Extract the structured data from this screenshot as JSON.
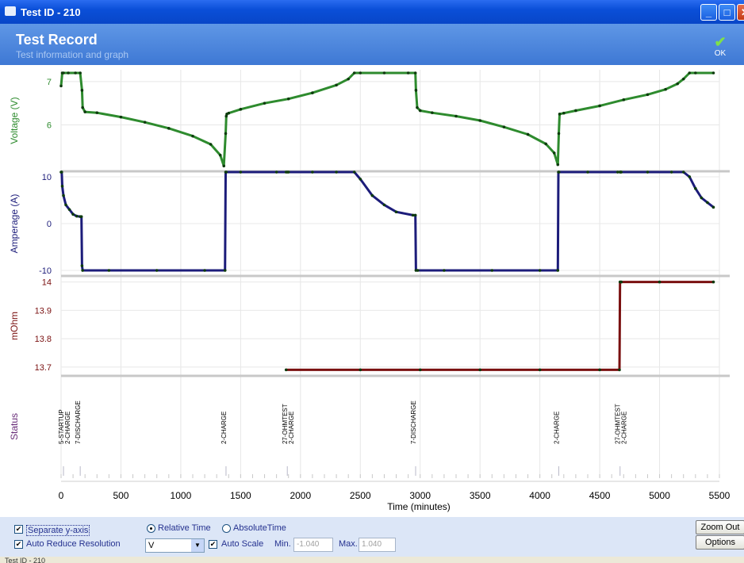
{
  "window": {
    "title": "Test ID - 210"
  },
  "header": {
    "title": "Test Record",
    "subtitle": "Test information and graph",
    "ok_label": "OK"
  },
  "chart_data": {
    "type": "line",
    "xlabel": "Time (minutes)",
    "xlim": [
      0,
      5500
    ],
    "x_ticks": [
      0,
      500,
      1000,
      1500,
      2000,
      2500,
      3000,
      3500,
      4000,
      4500,
      5000,
      5500
    ],
    "panels": [
      {
        "ylabel": "Voltage (V)",
        "color": "#2e8b2e",
        "y_ticks": [
          6,
          7
        ],
        "ylim": [
          5.0,
          7.2
        ],
        "series": [
          {
            "x": [
              0,
              10,
              20,
              60,
              120,
              160,
              175,
              180,
              200,
              300,
              500,
              700,
              900,
              1100,
              1250,
              1330,
              1360,
              1375,
              1380,
              1385,
              1400,
              1500,
              1700,
              1900,
              2100,
              2300,
              2400,
              2450,
              2500,
              2700,
              2900,
              2960,
              2965,
              2975,
              3000,
              3100,
              3300,
              3500,
              3700,
              3900,
              4050,
              4120,
              4150,
              4158,
              4165,
              4200,
              4300,
              4500,
              4700,
              4900,
              5050,
              5150,
              5200,
              5250,
              5300,
              5450
            ],
            "y": [
              6.9,
              7.2,
              7.2,
              7.2,
              7.2,
              7.2,
              6.8,
              6.4,
              6.3,
              6.28,
              6.18,
              6.06,
              5.92,
              5.74,
              5.55,
              5.3,
              5.05,
              5.8,
              6.2,
              6.25,
              6.27,
              6.36,
              6.5,
              6.6,
              6.74,
              6.92,
              7.06,
              7.2,
              7.2,
              7.2,
              7.2,
              7.2,
              6.8,
              6.4,
              6.33,
              6.28,
              6.2,
              6.1,
              5.95,
              5.78,
              5.56,
              5.35,
              5.08,
              5.8,
              6.25,
              6.27,
              6.33,
              6.44,
              6.58,
              6.7,
              6.82,
              6.95,
              7.06,
              7.2,
              7.2,
              7.2
            ]
          }
        ]
      },
      {
        "ylabel": "Amperage (A)",
        "color": "#1c1c7a",
        "y_ticks": [
          -10,
          0,
          10
        ],
        "ylim": [
          -10.5,
          10.5
        ],
        "series": [
          {
            "x": [
              0,
              5,
              10,
              20,
              40,
              70,
              100,
              130,
              160,
              170,
              175,
              180,
              400,
              800,
              1200,
              1370,
              1375,
              1380,
              1500,
              1800,
              1880,
              1890,
              1900,
              2100,
              2300,
              2450,
              2500,
              2600,
              2700,
              2800,
              2940,
              2960,
              2965,
              2980,
              3200,
              3600,
              4000,
              4150,
              4155,
              4160,
              4400,
              4650,
              4670,
              4675,
              4680,
              4900,
              5100,
              5200,
              5250,
              5300,
              5350,
              5400,
              5450
            ],
            "y": [
              11,
              11,
              8,
              6,
              4,
              3,
              2,
              1.6,
              1.5,
              1.5,
              -9,
              -10,
              -10,
              -10,
              -10,
              -10,
              11,
              11,
              11,
              11,
              11,
              11,
              11,
              11,
              11,
              11,
              9.5,
              6,
              4,
              2.5,
              1.8,
              1.8,
              -10,
              -10,
              -10,
              -10,
              -10,
              -10,
              11,
              11,
              11,
              11,
              11,
              11,
              11,
              11,
              11,
              11,
              10,
              7.5,
              5.5,
              4.5,
              3.5
            ]
          }
        ]
      },
      {
        "ylabel": "mOhm",
        "color": "#7a1010",
        "y_ticks": [
          13.7,
          13.8,
          13.9,
          14.0
        ],
        "ylim": [
          13.68,
          14.01
        ],
        "series": [
          {
            "x": [
              1880,
              2500,
              3000,
              3500,
              4000,
              4500,
              4665,
              4670,
              4680,
              5000,
              5450
            ],
            "y": [
              13.69,
              13.69,
              13.69,
              13.69,
              13.69,
              13.69,
              13.69,
              14.0,
              14.0,
              14.0,
              14.0
            ]
          }
        ]
      },
      {
        "ylabel": "Status",
        "color": "#6a2f7a",
        "events": [
          {
            "x": 20,
            "labels": [
              "5-STARTUP",
              "2-CHARGE"
            ]
          },
          {
            "x": 160,
            "labels": [
              "7-DISCHARGE"
            ]
          },
          {
            "x": 1378,
            "labels": [
              "2-CHARGE"
            ]
          },
          {
            "x": 1890,
            "labels": [
              "27-OHMTEST",
              "2-CHARGE"
            ]
          },
          {
            "x": 2962,
            "labels": [
              "7-DISCHARGE"
            ]
          },
          {
            "x": 4158,
            "labels": [
              "2-CHARGE"
            ]
          },
          {
            "x": 4670,
            "labels": [
              "27-OHMTEST",
              "2-CHARGE"
            ]
          }
        ]
      }
    ]
  },
  "controls": {
    "separate_y_axis": {
      "label": "Separate y-axis",
      "checked": "✔"
    },
    "auto_reduce": {
      "label": "Auto Reduce Resolution",
      "checked": "✔"
    },
    "relative_time": "Relative Time",
    "absolute_time": "AbsoluteTime",
    "series_select": "V",
    "select_arrow": "▼",
    "auto_scale": {
      "label": "Auto Scale",
      "checked": "✔"
    },
    "min_label": "Min.",
    "min_value": "-1.040",
    "max_label": "Max.",
    "max_value": "1.040",
    "zoom_out": "Zoom Out",
    "options": "Options"
  },
  "statusbar": {
    "text": "Test ID - 210"
  }
}
